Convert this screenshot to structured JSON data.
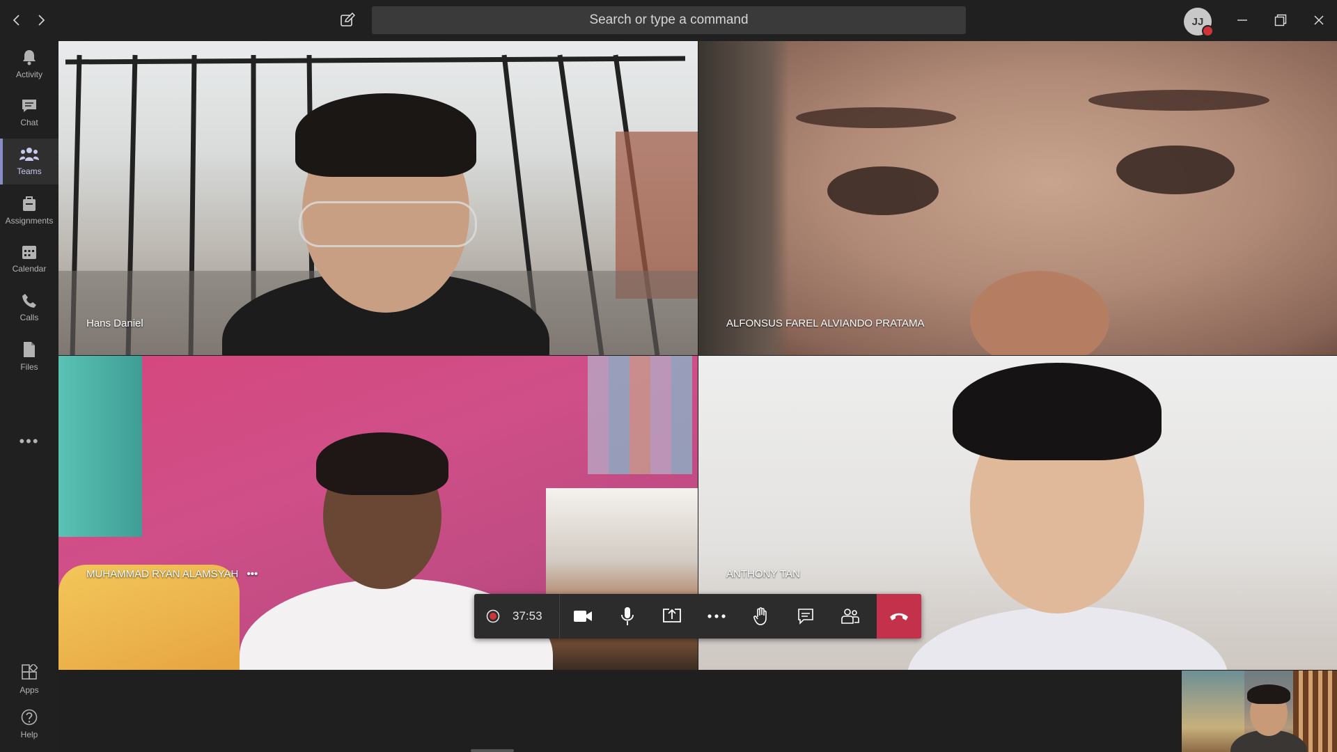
{
  "titlebar": {
    "back_icon": "chevron-left-icon",
    "forward_icon": "chevron-right-icon",
    "compose_icon": "compose-icon",
    "search_placeholder": "Search or type a command",
    "avatar_initials": "JJ",
    "status_color": "#d13438"
  },
  "rail": {
    "items": [
      {
        "label": "Activity",
        "icon": "bell-icon"
      },
      {
        "label": "Chat",
        "icon": "chat-icon"
      },
      {
        "label": "Teams",
        "icon": "teams-icon",
        "active": true
      },
      {
        "label": "Assignments",
        "icon": "assignments-icon"
      },
      {
        "label": "Calendar",
        "icon": "calendar-icon"
      },
      {
        "label": "Calls",
        "icon": "phone-icon"
      },
      {
        "label": "Files",
        "icon": "files-icon"
      }
    ],
    "more": "•••",
    "bottom": [
      {
        "label": "Apps",
        "icon": "apps-icon"
      },
      {
        "label": "Help",
        "icon": "help-icon"
      }
    ]
  },
  "participants": [
    {
      "name": "Hans Daniel"
    },
    {
      "name": "ALFONSUS FAREL ALVIANDO PRATAMA"
    },
    {
      "name": "MUHAMMAD RYAN ALAMSYAH",
      "more": "•••"
    },
    {
      "name": "ANTHONY TAN"
    }
  ],
  "controls": {
    "timer": "37:53",
    "record_icon": "record-icon",
    "buttons": [
      "camera-icon",
      "microphone-icon",
      "share-screen-icon",
      "more-icon",
      "raise-hand-icon",
      "chat-icon",
      "participants-icon"
    ],
    "hangup_icon": "hang-up-icon",
    "hangup_color": "#c4314b"
  },
  "accent": "#8b8cc7"
}
